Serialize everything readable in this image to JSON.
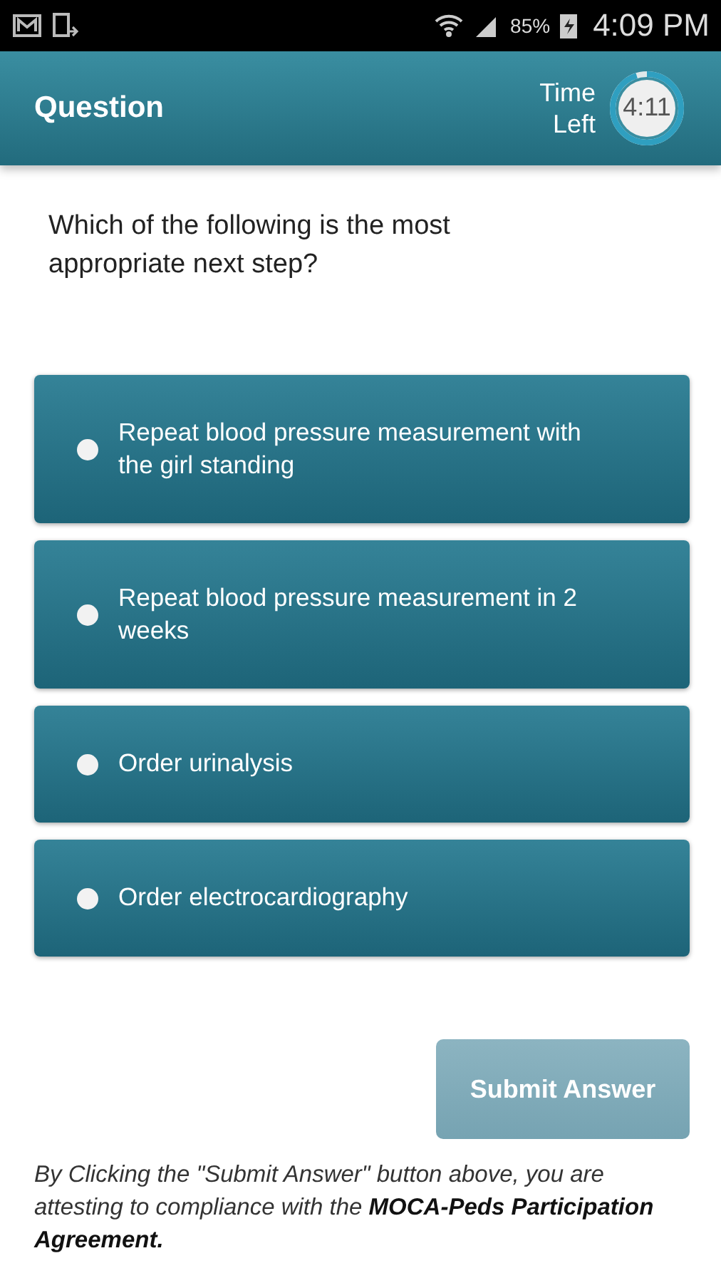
{
  "status_bar": {
    "battery": "85%",
    "time": "4:09 PM"
  },
  "app_bar": {
    "title": "Question",
    "timer_label": "Time Left",
    "timer": "4:11",
    "level": 0.95
  },
  "question": "Which of the following is the most appropriate next step?",
  "options": [
    {
      "label": "Repeat blood pressure measurement with the girl standing",
      "selected": false
    },
    {
      "label": "Repeat blood pressure measurement in 2 weeks",
      "selected": false
    },
    {
      "label": "Order urinalysis",
      "selected": false
    },
    {
      "label": "Order electrocardiography",
      "selected": false
    }
  ],
  "submit": {
    "label": "Submit Answer",
    "disabled": true
  },
  "disclaimer": "By Clicking the \"Submit Answer\" button above, you are attesting to compliance with the **MOCA-Peds Participation Agreement.**"
}
